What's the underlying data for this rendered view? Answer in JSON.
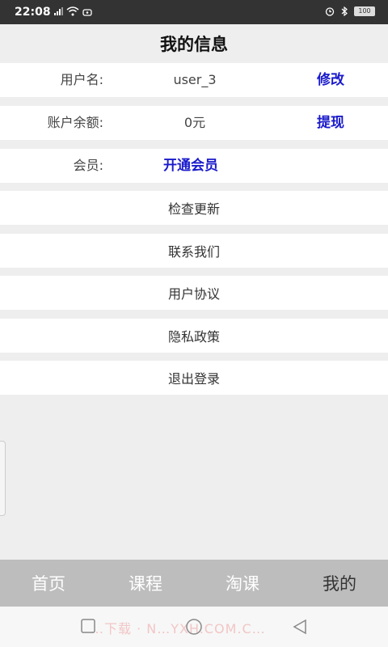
{
  "status_bar": {
    "time": "22:08",
    "battery": "100"
  },
  "header": {
    "title": "我的信息"
  },
  "account": {
    "username_label": "用户名:",
    "username_value": "user_3",
    "username_action": "修改",
    "balance_label": "账户余额:",
    "balance_value": "0元",
    "balance_action": "提现",
    "member_label": "会员:",
    "member_action": "开通会员"
  },
  "menu": {
    "check_update": "检查更新",
    "contact_us": "联系我们",
    "user_agreement": "用户协议",
    "privacy_policy": "隐私政策",
    "logout": "退出登录"
  },
  "tabs": {
    "home": "首页",
    "courses": "课程",
    "taoke": "淘课",
    "mine": "我的"
  },
  "watermark": "…下载 · N…YXH.COM.C…",
  "colors": {
    "link": "#1a1acc",
    "tab_bar": "#bdbdbd"
  }
}
